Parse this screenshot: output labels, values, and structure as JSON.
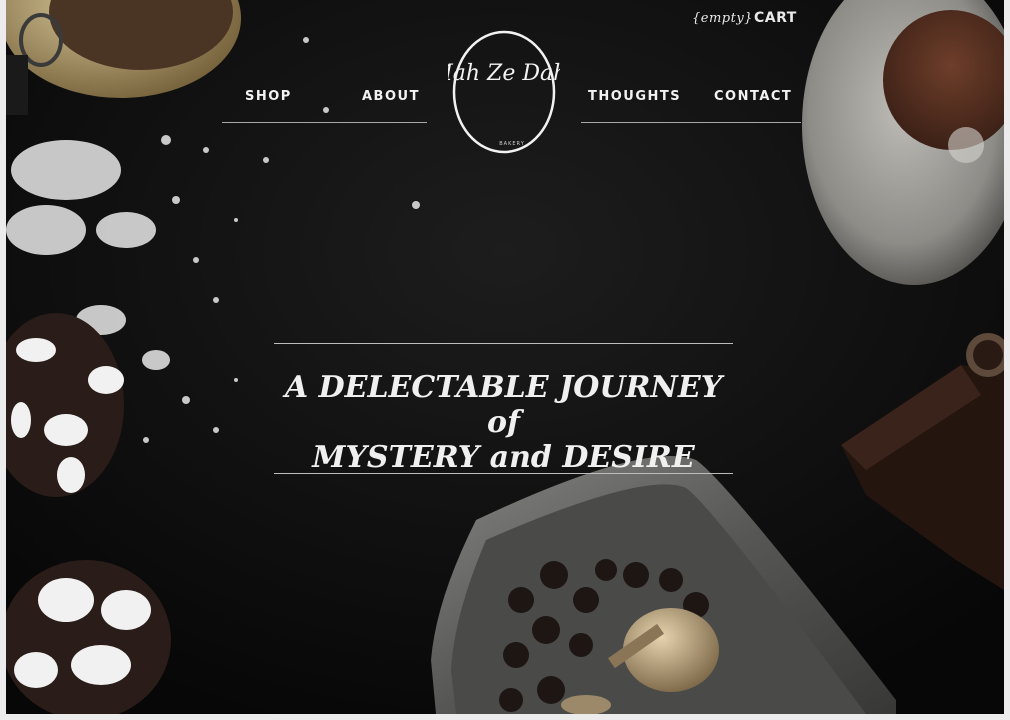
{
  "cart": {
    "status": "{empty}",
    "label": "CART"
  },
  "nav": {
    "shop": "SHOP",
    "about": "ABOUT",
    "thoughts": "THOUGHTS",
    "contact": "CONTACT"
  },
  "logo": {
    "script": "Mah Ze Dahr",
    "sub": "BAKERY"
  },
  "hero": {
    "line1": "A DELECTABLE JOURNEY of",
    "line2": "MYSTERY and DESIRE"
  },
  "colors": {
    "background": "#0c0c0c",
    "text": "#f0f0f0",
    "rule": "#bdbdbd"
  }
}
